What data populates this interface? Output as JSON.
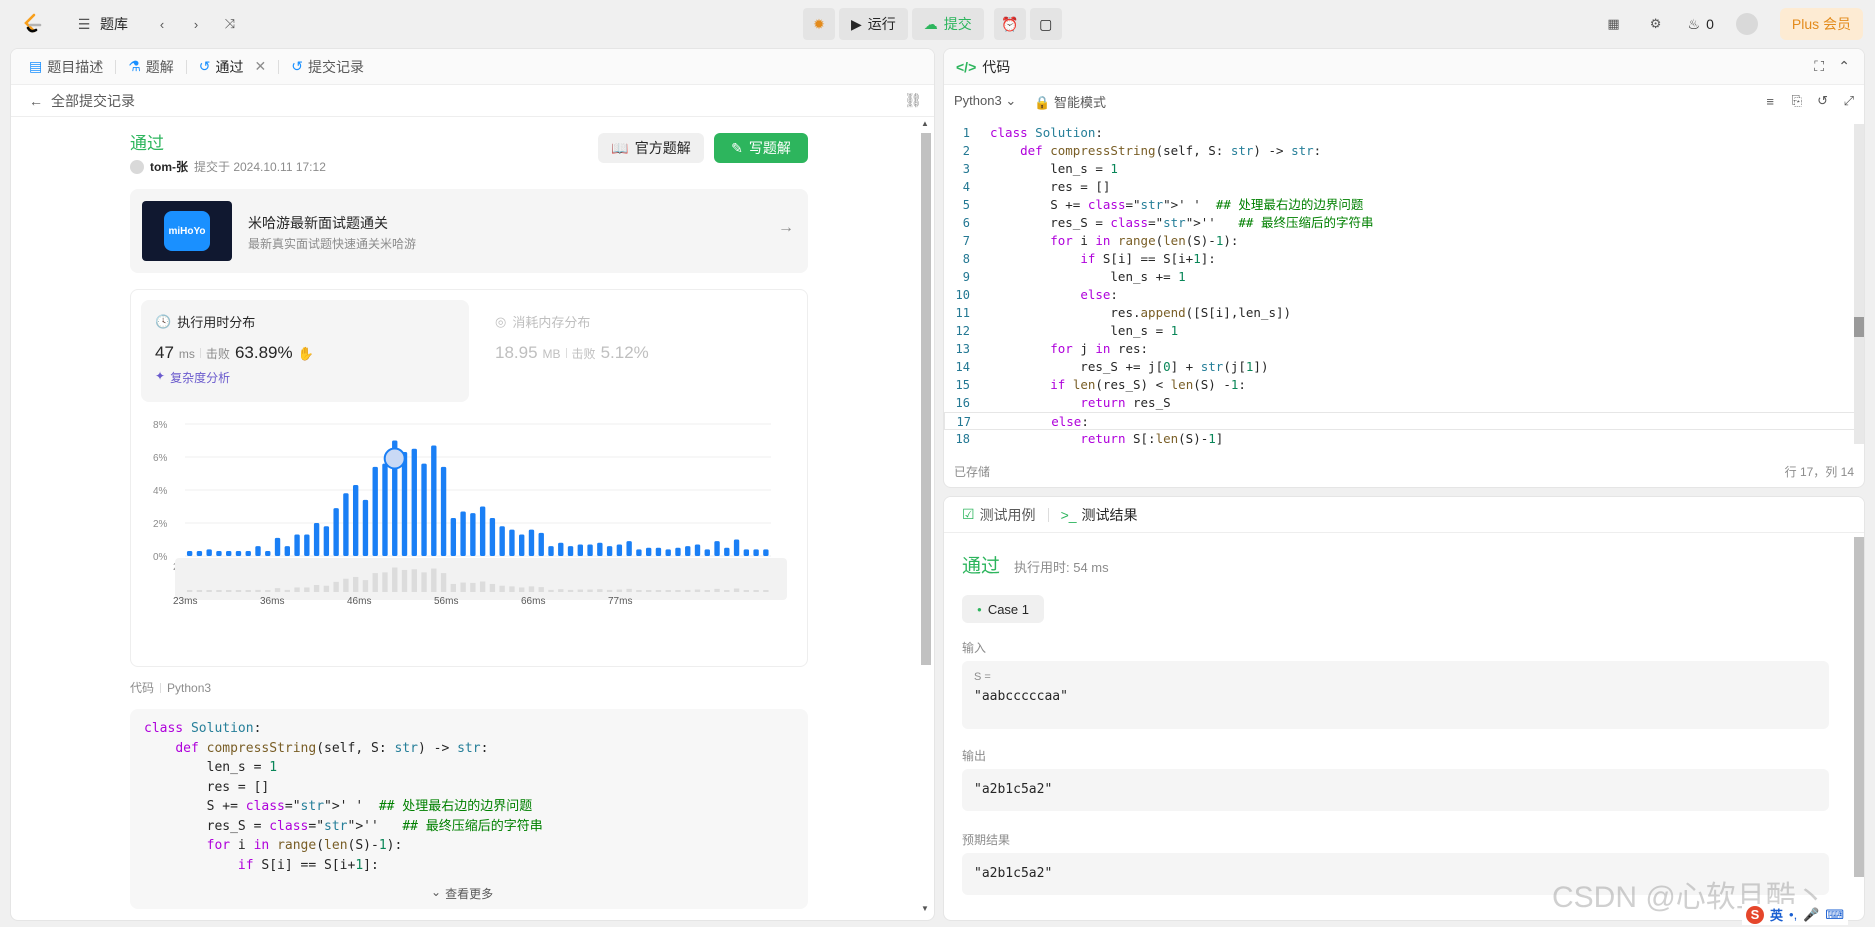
{
  "topbar": {
    "problems": "题库",
    "run": "运行",
    "submit": "提交",
    "fire_count": "0",
    "plus": "Plus 会员"
  },
  "left_tabs": {
    "desc": "题目描述",
    "solution": "题解",
    "pass": "通过",
    "records": "提交记录"
  },
  "back": "全部提交记录",
  "result": {
    "status": "通过",
    "user": "tom-张",
    "submitted_at": "提交于 2024.10.11 17:12",
    "official_btn": "官方题解",
    "write_btn": "写题解"
  },
  "ad": {
    "logo_text": "miHoYo",
    "title": "米哈游最新面试题通关",
    "subtitle": "最新真实面试题快速通关米哈游"
  },
  "runtime": {
    "title": "执行用时分布",
    "value": "47",
    "unit": "ms",
    "beat_label": "击败",
    "beat": "63.89%",
    "analysis": "复杂度分析"
  },
  "memory": {
    "title": "消耗内存分布",
    "value": "18.95",
    "unit": "MB",
    "beat_label": "击败",
    "beat": "5.12%"
  },
  "chart_data": {
    "type": "bar",
    "title": "",
    "xlabel": "",
    "ylabel": "",
    "y_ticks": [
      "8%",
      "6%",
      "4%",
      "2%",
      "0%"
    ],
    "x_ticks": [
      "23ms",
      "36ms",
      "46ms",
      "56ms",
      "66ms",
      "77ms"
    ],
    "ylim": [
      0,
      8
    ],
    "values": [
      0.3,
      0.3,
      0.4,
      0.3,
      0.3,
      0.3,
      0.3,
      0.6,
      0.3,
      1.1,
      0.6,
      1.3,
      1.3,
      2.0,
      1.8,
      2.9,
      3.8,
      4.3,
      3.4,
      5.4,
      5.6,
      7.0,
      6.3,
      6.5,
      5.6,
      6.7,
      5.4,
      2.3,
      2.7,
      2.6,
      3.0,
      2.3,
      1.8,
      1.6,
      1.3,
      1.6,
      1.4,
      0.6,
      0.8,
      0.6,
      0.7,
      0.7,
      0.8,
      0.6,
      0.7,
      0.9,
      0.4,
      0.5,
      0.5,
      0.4,
      0.5,
      0.6,
      0.7,
      0.4,
      0.9,
      0.5,
      1.0,
      0.4,
      0.4,
      0.4
    ],
    "highlight_index": 21
  },
  "code_section": {
    "label": "代码",
    "lang": "Python3",
    "more": "查看更多",
    "lines": [
      "class Solution:",
      "    def compressString(self, S: str) -> str:",
      "        len_s = 1",
      "        res = []",
      "        S += ' '  ## 处理最右边的边界问题",
      "        res_S = ''   ## 最终压缩后的字符串",
      "        for i in range(len(S)-1):",
      "            if S[i] == S[i+1]:"
    ]
  },
  "editor": {
    "title": "代码",
    "lang": "Python3",
    "mode": "智能模式",
    "saved": "已存储",
    "cursor": "行 17，列 14",
    "line_numbers": [
      "1",
      "2",
      "3",
      "4",
      "5",
      "6",
      "7",
      "8",
      "9",
      "10",
      "11",
      "12",
      "13",
      "14",
      "15",
      "16",
      "17",
      "18"
    ],
    "lines": [
      "class Solution:",
      "    def compressString(self, S: str) -> str:",
      "        len_s = 1",
      "        res = []",
      "        S += ' '  ## 处理最右边的边界问题",
      "        res_S = ''   ## 最终压缩后的字符串",
      "        for i in range(len(S)-1):",
      "            if S[i] == S[i+1]:",
      "                len_s += 1",
      "            else:",
      "                res.append([S[i],len_s])",
      "                len_s = 1",
      "        for j in res:",
      "            res_S += j[0] + str(j[1])",
      "        if len(res_S) < len(S) -1:",
      "            return res_S",
      "        else:",
      "            return S[:len(S)-1]"
    ]
  },
  "test": {
    "tab_cases": "测试用例",
    "tab_result": "测试结果",
    "status": "通过",
    "runtime": "执行用时: 54 ms",
    "case": "Case 1",
    "input_label": "输入",
    "input_var": "S =",
    "input_val": "\"aabcccccaa\"",
    "output_label": "输出",
    "output_val": "\"a2b1c5a2\"",
    "expected_label": "预期结果",
    "expected_val": "\"a2b1c5a2\""
  },
  "watermark": "CSDN @心软且酷丶",
  "ime": "英"
}
